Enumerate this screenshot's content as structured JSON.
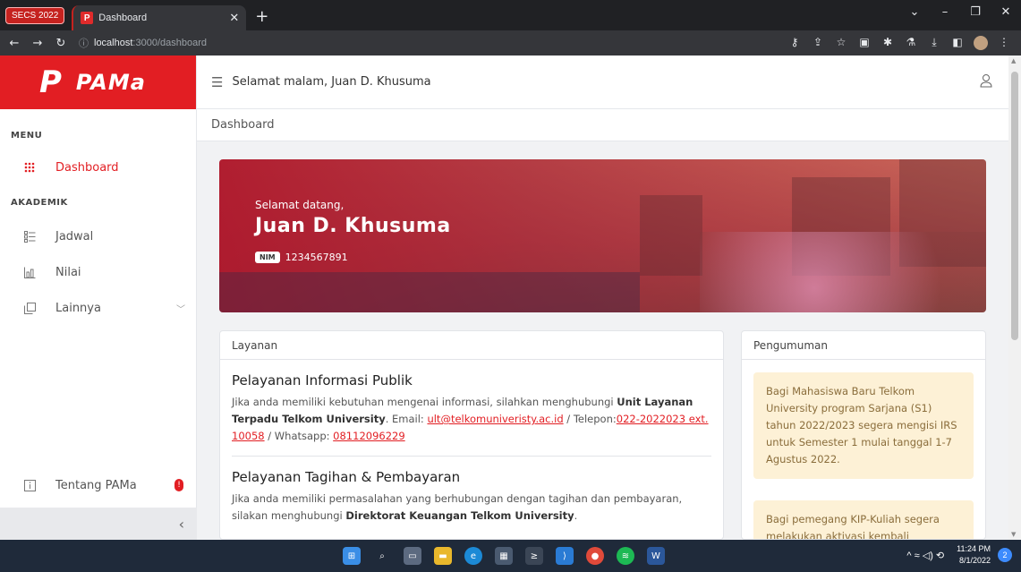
{
  "browser": {
    "tab_group": "SECS 2022",
    "tab_title": "Dashboard",
    "favicon": "P",
    "url_host": "localhost",
    "url_path": ":3000/dashboard"
  },
  "sidebar": {
    "logo_mark": "P",
    "logo_text": "PAMa",
    "menu_heading": "MENU",
    "akademik_heading": "AKADEMIK",
    "items": [
      {
        "label": "Dashboard",
        "icon": "grid-icon"
      },
      {
        "label": "Jadwal",
        "icon": "list-icon"
      },
      {
        "label": "Nilai",
        "icon": "chart-icon"
      },
      {
        "label": "Lainnya",
        "icon": "copy-icon"
      },
      {
        "label": "Tentang PAMa",
        "icon": "info-icon",
        "badge": "!"
      }
    ]
  },
  "topbar": {
    "greeting": "Selamat malam, Juan D. Khusuma",
    "breadcrumb": "Dashboard"
  },
  "hero": {
    "welcome": "Selamat datang,",
    "name": "Juan D. Khusuma",
    "nim_label": "NIM",
    "nim": "1234567891"
  },
  "layanan": {
    "title": "Layanan",
    "services": [
      {
        "title": "Pelayanan Informasi Publik",
        "text1": "Jika anda memiliki kebutuhan mengenai informasi, silahkan menghubungi ",
        "bold": "Unit Layanan Terpadu Telkom University",
        "text2": ". Email: ",
        "email": "ult@telkomuniveristy.ac.id",
        "text3": " / Telepon:",
        "phone": "022-2022023 ext. 10058",
        "text4": " / Whatsapp: ",
        "whatsapp": "08112096229"
      },
      {
        "title": "Pelayanan Tagihan & Pembayaran",
        "text1": "Jika anda memiliki permasalahan yang berhubungan dengan tagihan dan pembayaran, silakan menghubungi ",
        "bold": "Direktorat Keuangan Telkom University",
        "text2": "."
      }
    ]
  },
  "pengumuman": {
    "title": "Pengumuman",
    "notices": [
      "Bagi Mahasiswa Baru Telkom University program Sarjana (S1) tahun 2022/2023 segera mengisi IRS untuk Semester 1 mulai tanggal 1-7 Agustus 2022.",
      "Bagi pemegang KIP-Kuliah segera melakukan aktivasi kembali"
    ]
  },
  "taskbar": {
    "time": "11:24 PM",
    "date": "8/1/2022",
    "notifications": "2"
  },
  "colors": {
    "brand": "#e21e23",
    "notice_bg": "#fdf1d6"
  }
}
